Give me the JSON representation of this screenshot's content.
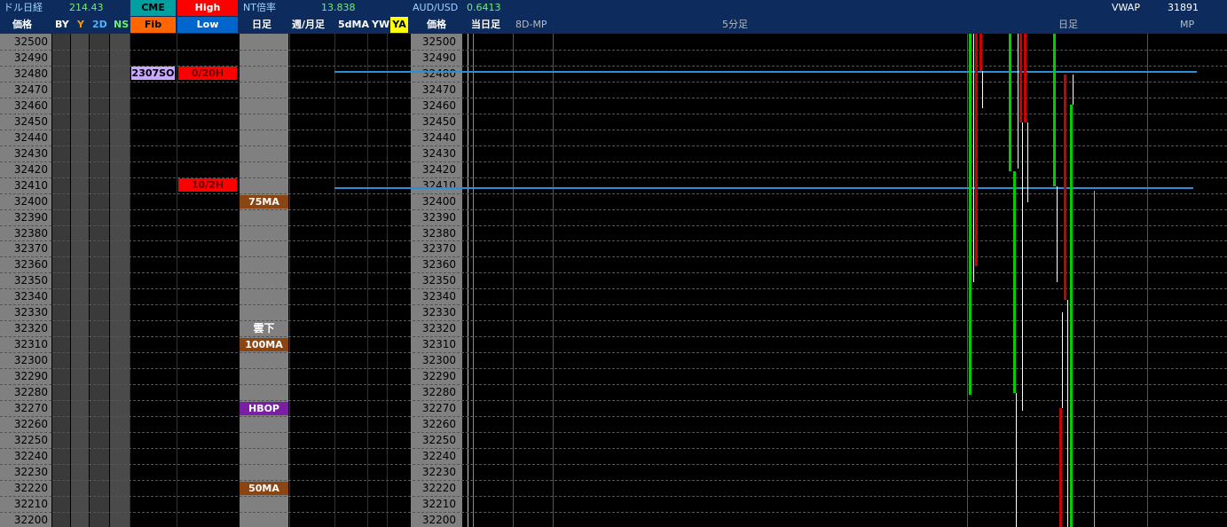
{
  "header": {
    "usdnikkei_label": "ドル日経",
    "usdnikkei_value": "214.43",
    "cme_label": "CME",
    "high_label": "High",
    "nt_label": "NT倍率",
    "nt_value": "13.838",
    "audusd_label": "AUD/USD",
    "audusd_value": "0.6413",
    "vwap_label": "VWAP",
    "vwap_value": "31891"
  },
  "subheader": {
    "price_label_left": "価格",
    "by": "BY",
    "y": "Y",
    "d2": "2D",
    "ns": "NS",
    "fib": "Fib",
    "low": "Low",
    "daily": "日足",
    "weekly_monthly": "週/月足",
    "ma5d": "5dMA",
    "yw": "YW",
    "ya": "YA",
    "price_label_mid": "価格",
    "today_daily": "当日足",
    "mp8d": "8D-MP",
    "min5": "5分足",
    "daily_right": "日足",
    "mp": "MP"
  },
  "prices": [
    "32500",
    "32490",
    "32480",
    "32470",
    "32460",
    "32450",
    "32440",
    "32430",
    "32420",
    "32410",
    "32400",
    "32390",
    "32380",
    "32370",
    "32360",
    "32350",
    "32340",
    "32330",
    "32320",
    "32310",
    "32300",
    "32290",
    "32280",
    "32270",
    "32260",
    "32250",
    "32240",
    "32230",
    "32220",
    "32210",
    "32200"
  ],
  "markers": {
    "cme_2307so": "2307SO",
    "high_0720": "0/20H",
    "high_1020": "10/2H",
    "ma75": "75MA",
    "cloud_below": "雲下",
    "ma100": "100MA",
    "hbop": "HBOP",
    "ma50": "50MA"
  },
  "colors": {
    "header_bg": "#0d2b5c",
    "price_col_bg": "#808080",
    "cme_bg": "#00a0a0",
    "high_bg": "#ff0000",
    "fib_bg": "#ff6600",
    "low_bg": "#0066cc",
    "ma_badge": "#8b4513",
    "hbop_badge": "#7b1fa2",
    "line_blue": "#2a8fd6",
    "green": "#00cc00",
    "red": "#cc0000"
  }
}
